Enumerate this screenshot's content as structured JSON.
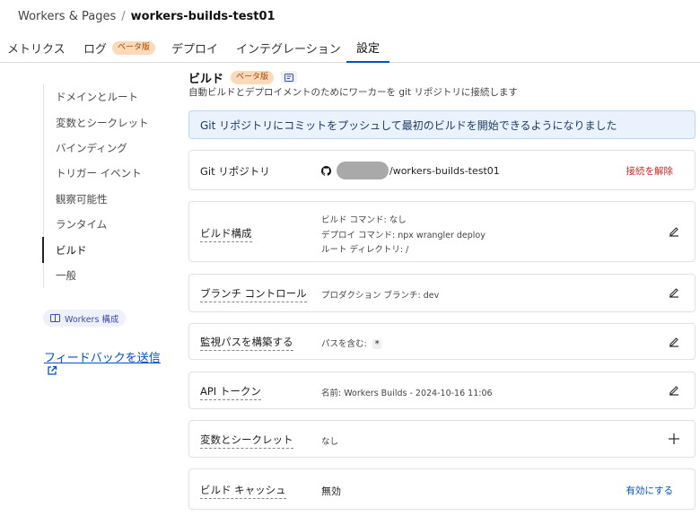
{
  "breadcrumb": {
    "parent": "Workers & Pages",
    "separator": "/",
    "current": "workers-builds-test01"
  },
  "tabs": [
    {
      "label": "メトリクス"
    },
    {
      "label": "ログ",
      "badge": "ベータ版"
    },
    {
      "label": "デプロイ"
    },
    {
      "label": "インテグレーション"
    },
    {
      "label": "設定",
      "active": true
    }
  ],
  "sidebar": {
    "items": [
      {
        "label": "ドメインとルート"
      },
      {
        "label": "変数とシークレット"
      },
      {
        "label": "バインディング"
      },
      {
        "label": "トリガー イベント"
      },
      {
        "label": "観察可能性"
      },
      {
        "label": "ランタイム"
      },
      {
        "label": "ビルド",
        "active": true
      },
      {
        "label": "一般"
      }
    ],
    "workers_badge": "Workers 構成",
    "feedback": "フィードバックを送信"
  },
  "build": {
    "title": "ビルド",
    "badge": "ベータ版",
    "description": "自動ビルドとデプロイメントのためにワーカーを git リポジトリに接続します",
    "banner": "Git リポジトリにコミットをプッシュして最初のビルドを開始できるようになりました"
  },
  "cards": {
    "git": {
      "label": "Git リポジトリ",
      "repo": "/workers-builds-test01",
      "action": "接続を解除"
    },
    "build_config": {
      "label": "ビルド構成",
      "build_command": "ビルド コマンド: なし",
      "deploy_command": "デプロイ コマンド: npx wrangler deploy",
      "root_dir": "ルート ディレクトリ: /"
    },
    "branch": {
      "label": "ブランチ コントロール",
      "value": "プロダクション ブランチ: dev"
    },
    "watch_paths": {
      "label": "監視パスを構築する",
      "value": "パスを含む:",
      "pattern": "*"
    },
    "api_token": {
      "label": "API トークン",
      "value": "名前: Workers Builds - 2024-10-16 11:06"
    },
    "variables": {
      "label": "変数とシークレット",
      "value": "なし"
    },
    "cache": {
      "label": "ビルド キャッシュ",
      "value": "無効",
      "action": "有効にする"
    }
  },
  "colors": {
    "accent": "#0051c3",
    "danger": "#c92a2a",
    "beta_bg": "#fcd9b8",
    "banner_bg": "#eaf3fd"
  }
}
